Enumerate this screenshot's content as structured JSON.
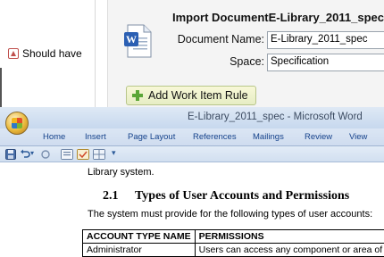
{
  "background_page": {
    "priority_label": "Should have",
    "import_title": "Import DocumentE-Library_2011_spec",
    "document_name_label": "Document Name:",
    "document_name_value": "E-Library_2011_spec",
    "space_label": "Space:",
    "space_value": "Specification",
    "add_rule_label": "Add Work Item Rule"
  },
  "word": {
    "window_title": "E-Library_2011_spec - Microsoft Word",
    "tabs": [
      "Home",
      "Insert",
      "Page Layout",
      "References",
      "Mailings",
      "Review",
      "View"
    ],
    "qat_dropdown_glyph": "▾",
    "document": {
      "line1": "Library system.",
      "heading_number": "2.1",
      "heading_text": "Types of User Accounts and Permissions",
      "intro": "The system must provide for the following types of user accounts:",
      "table": {
        "headers": [
          "ACCOUNT TYPE NAME",
          "PERMISSIONS"
        ],
        "rows": [
          [
            "Administrator",
            "Users can access any component or area of"
          ]
        ]
      }
    }
  },
  "colors": {
    "ribbon_text": "#15428b",
    "add_rule_plus": "#5aa637",
    "priority_arrow": "#c0504d"
  }
}
